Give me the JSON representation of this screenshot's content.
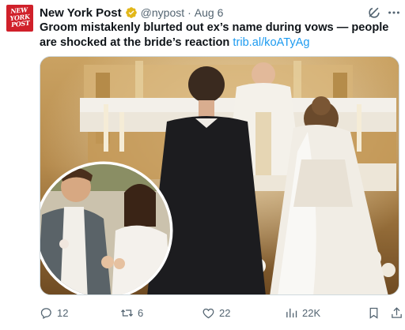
{
  "tweet": {
    "author_name": "New York Post",
    "handle": "@nypost",
    "separator": "·",
    "date": "Aug 6",
    "text": "Groom mistakenly blurted out ex’s name during vows — people are shocked at the bride’s reaction",
    "link": "trib.al/koATyAg",
    "avatar_text_line1": "NEW",
    "avatar_text_line2": "YORK",
    "avatar_text_line3": "POST"
  },
  "icons": {
    "verified": "verified-badge-gold",
    "grok": "grok-icon",
    "more": "more-icon",
    "reply": "reply-icon",
    "retweet": "retweet-icon",
    "like": "like-icon",
    "views": "views-icon",
    "bookmark": "bookmark-icon",
    "share": "share-icon"
  },
  "actions": {
    "reply_count": "12",
    "retweet_count": "6",
    "like_count": "22",
    "views_count": "22K"
  },
  "colors": {
    "brand_red": "#d0202a",
    "verified_gold": "#e2b719",
    "link_blue": "#1d9bf0",
    "muted": "#536471"
  }
}
